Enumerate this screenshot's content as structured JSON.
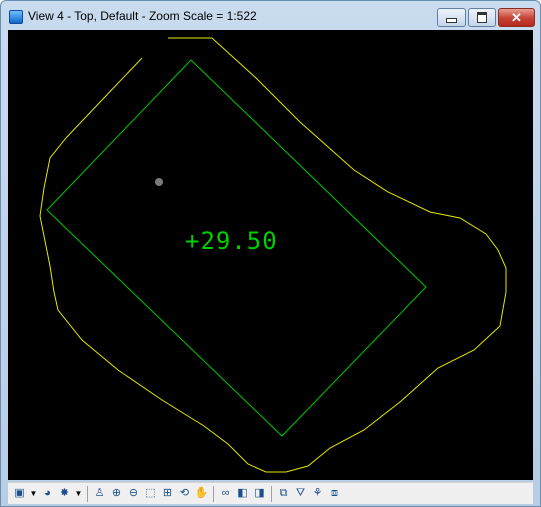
{
  "window": {
    "title": "View 4 - Top, Default - Zoom Scale = 1:522",
    "close_glyph": "✕"
  },
  "canvas": {
    "background": "#000000",
    "rectangle_color": "#00c800",
    "boundary_color": "#e6e600",
    "point_color": "#7a7a7a",
    "elevation_label": "+29.50"
  },
  "toolbar": {
    "icons": [
      {
        "name": "view-attributes-icon",
        "glyph": "▣"
      },
      {
        "name": "dropdown-arrow-icon",
        "glyph": "▼"
      },
      {
        "name": "display-style-icon",
        "glyph": "◕"
      },
      {
        "name": "lighting-icon",
        "glyph": "✸"
      },
      {
        "name": "dropdown-arrow-icon",
        "glyph": "▼"
      },
      {
        "name": "separator"
      },
      {
        "name": "update-view-icon",
        "glyph": "♙"
      },
      {
        "name": "zoom-in-icon",
        "glyph": "⊕"
      },
      {
        "name": "zoom-out-icon",
        "glyph": "⊖"
      },
      {
        "name": "window-area-icon",
        "glyph": "⬚"
      },
      {
        "name": "fit-view-icon",
        "glyph": "⊞"
      },
      {
        "name": "rotate-view-icon",
        "glyph": "⟲"
      },
      {
        "name": "pan-view-icon",
        "glyph": "✋"
      },
      {
        "name": "separator"
      },
      {
        "name": "walk-icon",
        "glyph": "∞"
      },
      {
        "name": "previous-view-icon",
        "glyph": "◧"
      },
      {
        "name": "next-view-icon",
        "glyph": "◨"
      },
      {
        "name": "separator"
      },
      {
        "name": "view-rotation-icon",
        "glyph": "⧉"
      },
      {
        "name": "clip-volume-icon",
        "glyph": "⛛"
      },
      {
        "name": "clip-mask-icon",
        "glyph": "⚘"
      },
      {
        "name": "camera-icon",
        "glyph": "⧈"
      }
    ]
  }
}
